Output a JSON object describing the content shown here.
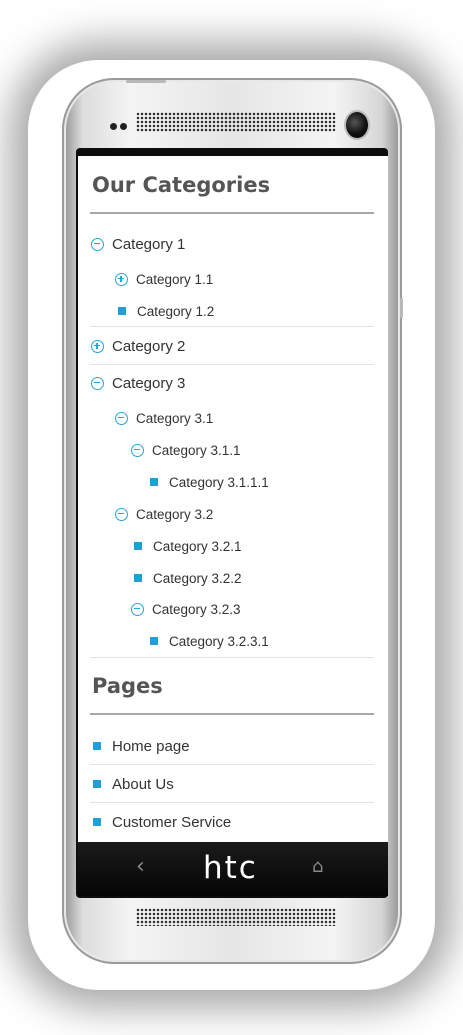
{
  "phone": {
    "brand": "htc",
    "nav_back_icon": "‹",
    "nav_home_icon": "⌂"
  },
  "categories": {
    "title": "Our Categories",
    "items": [
      {
        "label": "Category 1",
        "icon": "minus-circle-icon"
      },
      {
        "label": "Category 1.1",
        "icon": "plus-circle-icon"
      },
      {
        "label": "Category 1.2",
        "icon": "square-bullet-icon"
      },
      {
        "label": "Category 2",
        "icon": "plus-circle-icon"
      },
      {
        "label": "Category 3",
        "icon": "minus-circle-icon"
      },
      {
        "label": "Category 3.1",
        "icon": "minus-circle-icon"
      },
      {
        "label": "Category 3.1.1",
        "icon": "minus-circle-icon"
      },
      {
        "label": "Category 3.1.1.1",
        "icon": "square-bullet-icon"
      },
      {
        "label": "Category 3.2",
        "icon": "minus-circle-icon"
      },
      {
        "label": "Category 3.2.1",
        "icon": "square-bullet-icon"
      },
      {
        "label": "Category 3.2.2",
        "icon": "square-bullet-icon"
      },
      {
        "label": "Category 3.2.3",
        "icon": "minus-circle-icon"
      },
      {
        "label": "Category 3.2.3.1",
        "icon": "square-bullet-icon"
      }
    ]
  },
  "pages": {
    "title": "Pages",
    "items": [
      {
        "label": "Home page",
        "icon": "square-bullet-icon"
      },
      {
        "label": "About Us",
        "icon": "square-bullet-icon"
      },
      {
        "label": "Customer Service",
        "icon": "square-bullet-icon"
      }
    ]
  },
  "colors": {
    "accent": "#23a6d8",
    "title": "#555555",
    "text": "#333333"
  }
}
